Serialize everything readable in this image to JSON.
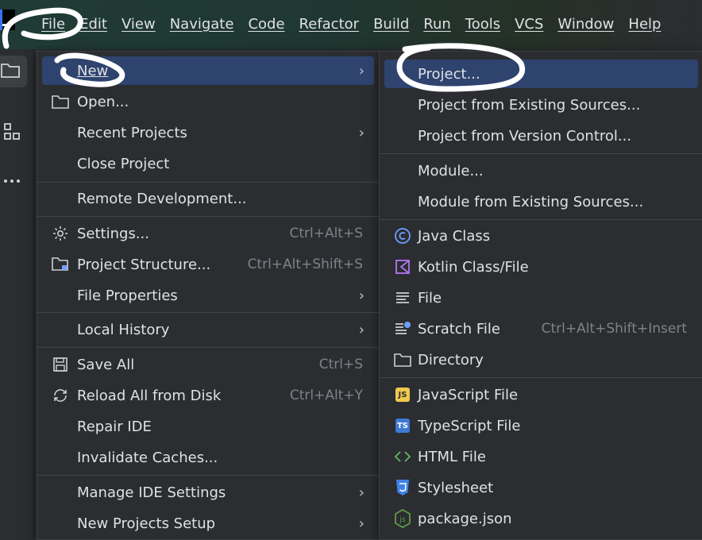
{
  "menubar": [
    "File",
    "Edit",
    "View",
    "Navigate",
    "Code",
    "Refactor",
    "Build",
    "Run",
    "Tools",
    "VCS",
    "Window",
    "Help"
  ],
  "file_menu": {
    "new": "New",
    "open": "Open...",
    "recent_projects": "Recent Projects",
    "close_project": "Close Project",
    "remote_development": "Remote Development...",
    "settings": "Settings...",
    "settings_shortcut": "Ctrl+Alt+S",
    "project_structure": "Project Structure...",
    "project_structure_shortcut": "Ctrl+Alt+Shift+S",
    "file_properties": "File Properties",
    "local_history": "Local History",
    "save_all": "Save All",
    "save_all_shortcut": "Ctrl+S",
    "reload_all": "Reload All from Disk",
    "reload_all_shortcut": "Ctrl+Alt+Y",
    "repair_ide": "Repair IDE",
    "invalidate_caches": "Invalidate Caches...",
    "manage_ide_settings": "Manage IDE Settings",
    "new_projects_setup": "New Projects Setup"
  },
  "new_submenu": {
    "project": "Project...",
    "project_existing": "Project from Existing Sources...",
    "project_vcs": "Project from Version Control...",
    "module": "Module...",
    "module_existing": "Module from Existing Sources...",
    "java_class": "Java Class",
    "kotlin_class": "Kotlin Class/File",
    "file": "File",
    "scratch_file": "Scratch File",
    "scratch_file_shortcut": "Ctrl+Alt+Shift+Insert",
    "directory": "Directory",
    "javascript_file": "JavaScript File",
    "typescript_file": "TypeScript File",
    "html_file": "HTML File",
    "stylesheet": "Stylesheet",
    "package_json": "package.json"
  },
  "badges": {
    "js": "JS",
    "ts": "TS"
  },
  "colors": {
    "accent": "#3574f0",
    "selection": "#2e436e",
    "js": "#f0c94e",
    "ts": "#3e79d4",
    "java": "#6f9fff",
    "kotlin": "#b476f5",
    "html": "#5fb865",
    "css": "#3f83e8",
    "node": "#5fa04e"
  }
}
